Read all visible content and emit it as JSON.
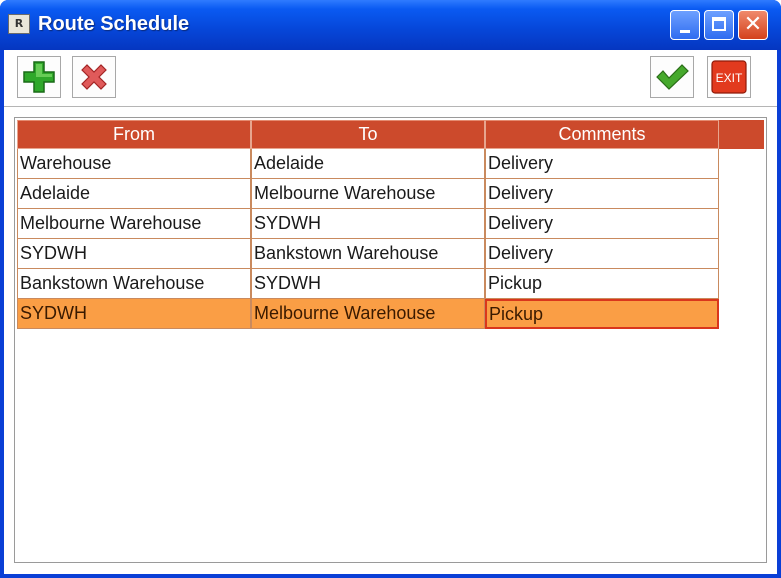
{
  "window": {
    "title": "Route Schedule",
    "icon_label": "R"
  },
  "toolbar": {
    "add": "add-icon",
    "delete": "delete-icon",
    "confirm": "checkmark-icon",
    "exit_label": "EXIT"
  },
  "table": {
    "columns": [
      "From",
      "To",
      "Comments"
    ],
    "rows": [
      {
        "from": "Warehouse",
        "to": "Adelaide",
        "comments": "Delivery"
      },
      {
        "from": "Adelaide",
        "to": "Melbourne Warehouse",
        "comments": "Delivery"
      },
      {
        "from": "Melbourne Warehouse",
        "to": "SYDWH",
        "comments": "Delivery"
      },
      {
        "from": "SYDWH",
        "to": "Bankstown Warehouse",
        "comments": "Delivery"
      },
      {
        "from": "Bankstown Warehouse",
        "to": "SYDWH",
        "comments": "Pickup"
      },
      {
        "from": "SYDWH",
        "to": "Melbourne Warehouse",
        "comments": "Pickup"
      }
    ],
    "selected_row": 5
  },
  "colors": {
    "header": "#cc4a2c",
    "selected_row": "#fa9e45",
    "title_bar": "#0646d8"
  }
}
